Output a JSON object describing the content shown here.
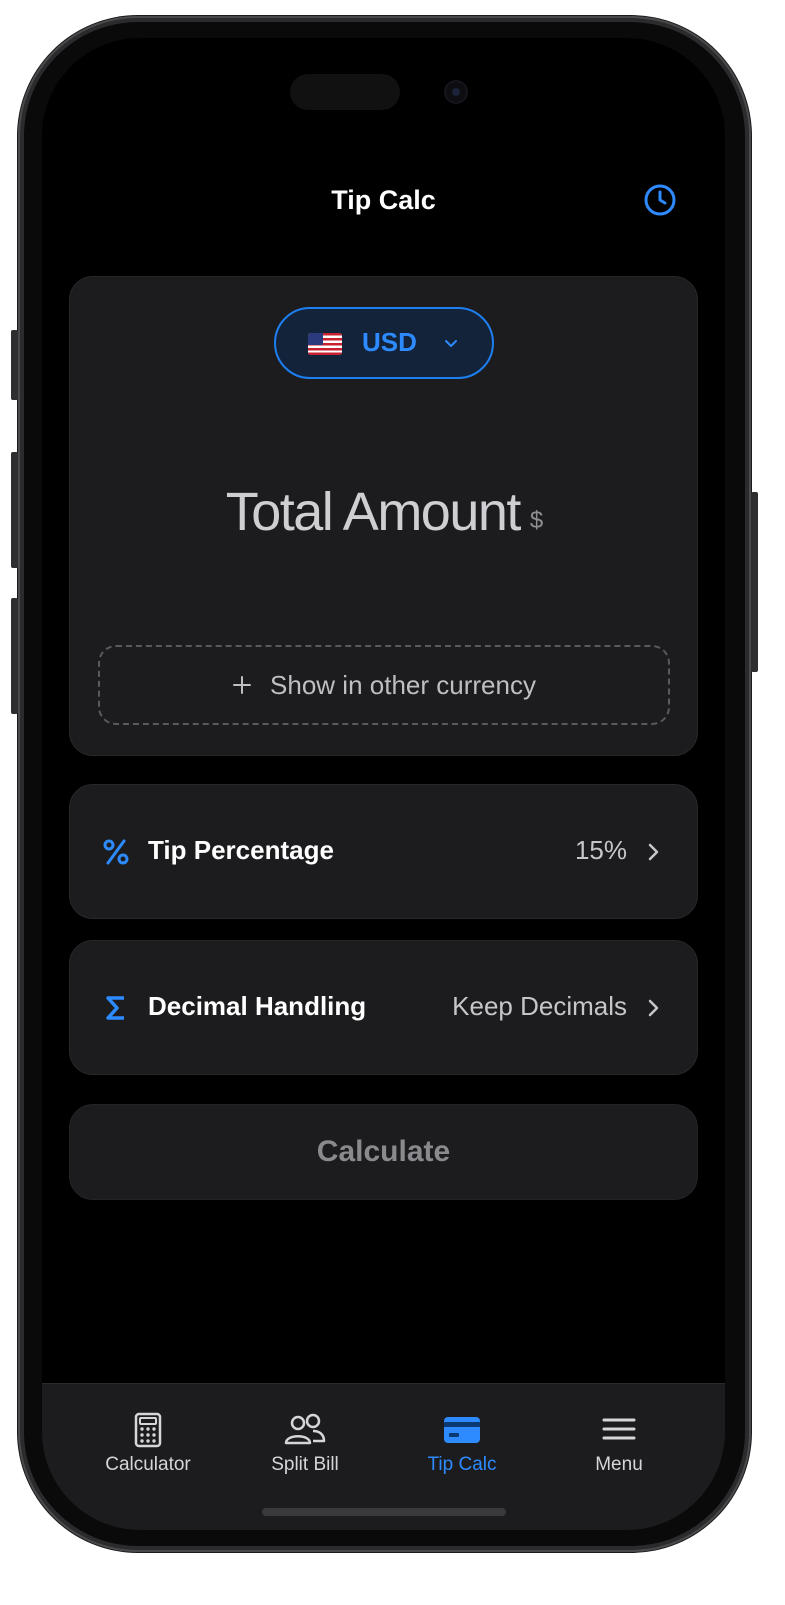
{
  "nav": {
    "title": "Tip Calc",
    "history_icon": "clock-icon"
  },
  "currency": {
    "flag_icon": "us-flag-icon",
    "code": "USD",
    "dropdown_icon": "chevron-down-icon"
  },
  "amount": {
    "placeholder": "Total Amount",
    "symbol": "$"
  },
  "other_currency": {
    "icon": "plus-icon",
    "label": "Show in other currency"
  },
  "tip_percentage": {
    "icon": "percent-icon",
    "label": "Tip Percentage",
    "value": "15%"
  },
  "decimal_handling": {
    "icon": "sigma-icon",
    "label": "Decimal Handling",
    "value": "Keep Decimals"
  },
  "calculate": {
    "label": "Calculate"
  },
  "tabs": [
    {
      "label": "Calculator",
      "icon": "calculator-icon",
      "active": false
    },
    {
      "label": "Split Bill",
      "icon": "people-icon",
      "active": false
    },
    {
      "label": "Tip Calc",
      "icon": "credit-card-icon",
      "active": true
    },
    {
      "label": "Menu",
      "icon": "hamburger-menu-icon",
      "active": false
    }
  ],
  "colors": {
    "accent": "#2d8bff",
    "card": "#1c1c1e",
    "background": "#000000"
  }
}
